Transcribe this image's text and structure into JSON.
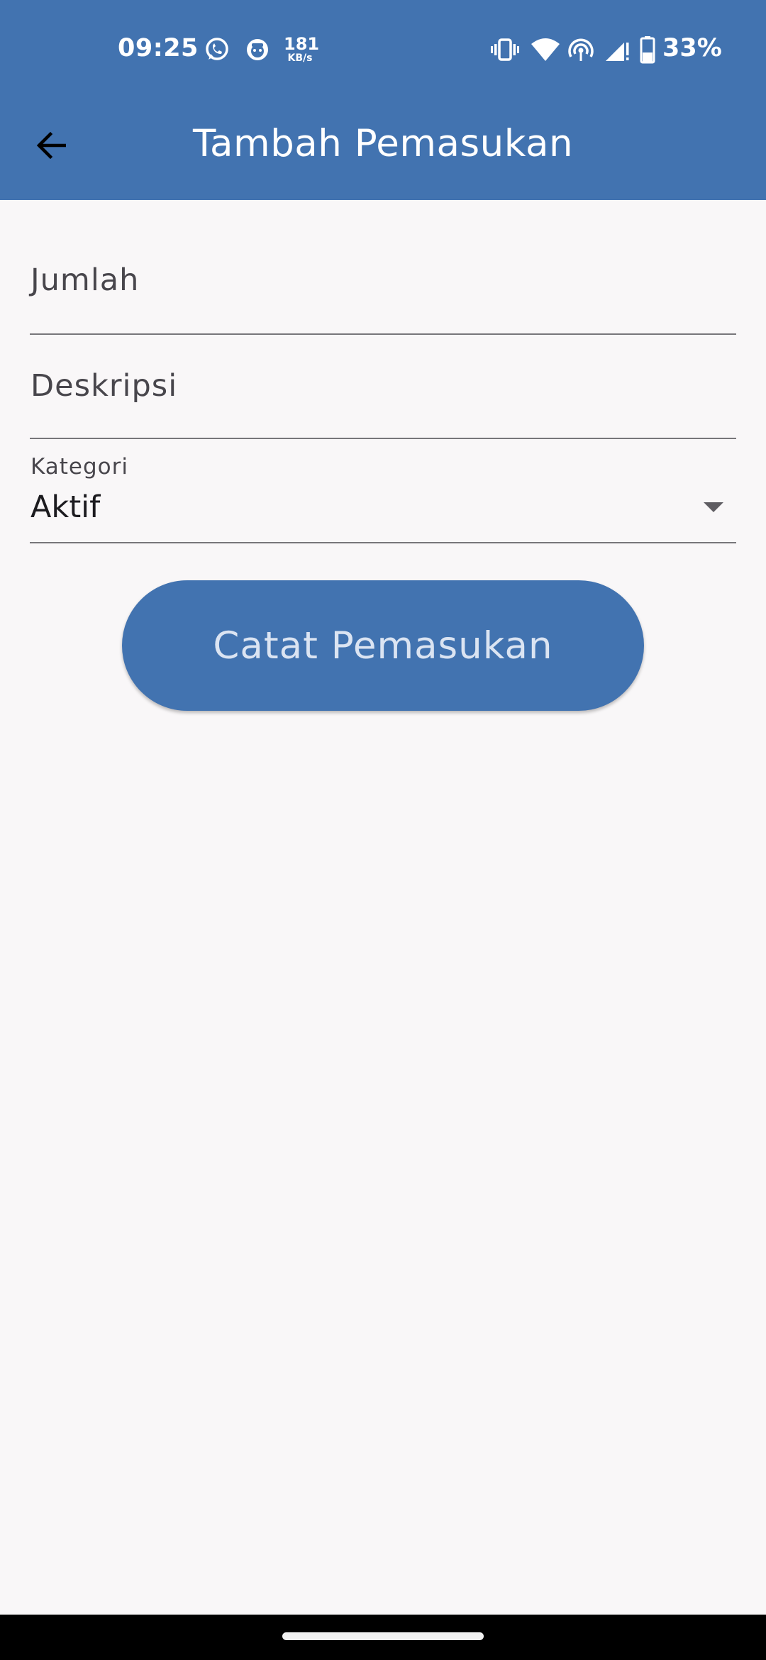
{
  "status_bar": {
    "time": "09:25",
    "net_speed_value": "181",
    "net_speed_unit": "KB/s",
    "battery_percent": "33%",
    "icons": [
      "whatsapp-icon",
      "app-notification-icon",
      "vibrate-icon",
      "wifi-icon",
      "hotspot-icon",
      "signal-icon",
      "battery-icon"
    ]
  },
  "app_bar": {
    "title": "Tambah Pemasukan",
    "back_icon": "arrow-left-icon",
    "background_color": "#4273b0"
  },
  "form": {
    "jumlah_placeholder": "Jumlah",
    "deskripsi_placeholder": "Deskripsi",
    "kategori_label": "Kategori",
    "kategori_value": "Aktif",
    "submit_label": "Catat Pemasukan"
  },
  "colors": {
    "accent": "#4273b0",
    "background": "#f9f7f8",
    "button_text": "#dbe4f2"
  }
}
